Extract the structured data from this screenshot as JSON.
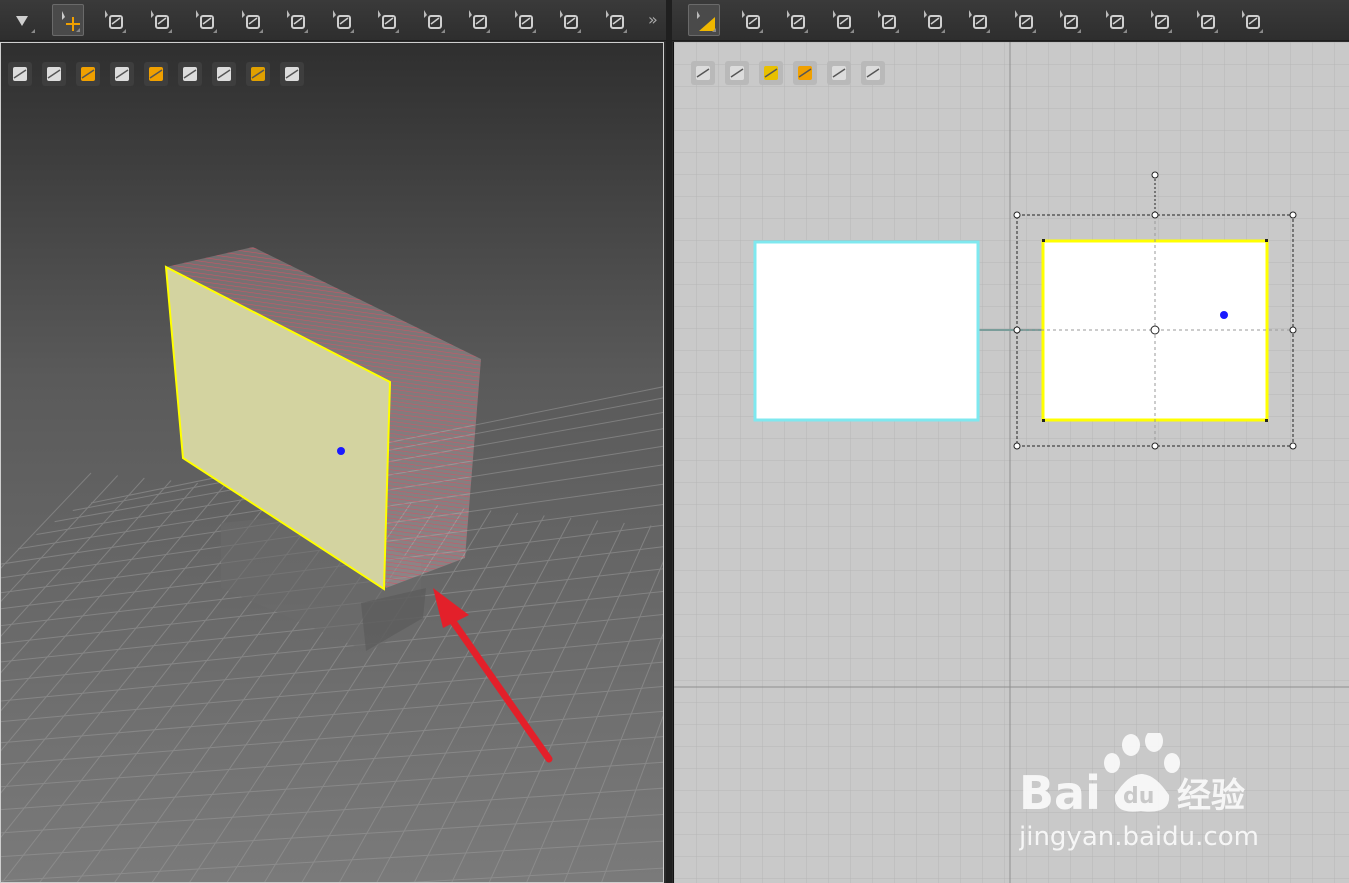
{
  "left_toolbar": {
    "tools": [
      {
        "name": "drop-down-arrow-icon",
        "active": false
      },
      {
        "name": "transform-move-icon",
        "active": true
      },
      {
        "name": "select-mesh-icon",
        "active": false
      },
      {
        "name": "garment-select-icon",
        "active": false
      },
      {
        "name": "pin-tool-icon",
        "active": false
      },
      {
        "name": "fold-arrangement-icon",
        "active": false
      },
      {
        "name": "tack-tool-icon",
        "active": false
      },
      {
        "name": "avatar-arrangement-icon",
        "active": false
      },
      {
        "name": "sewing-tool-icon",
        "active": false
      },
      {
        "name": "grid-mesh-icon",
        "active": false
      },
      {
        "name": "measure-tool-icon",
        "active": false
      },
      {
        "name": "strength-map-icon",
        "active": false
      },
      {
        "name": "button-tool-icon",
        "active": false
      },
      {
        "name": "zipper-tool-icon",
        "active": false
      }
    ],
    "overflow_label": "»"
  },
  "right_toolbar": {
    "tools": [
      {
        "name": "edit-pattern-icon",
        "active": true
      },
      {
        "name": "edit-points-icon",
        "active": false
      },
      {
        "name": "rectangle-tool-icon",
        "active": false
      },
      {
        "name": "polygon-tool-icon",
        "active": false
      },
      {
        "name": "internal-shape-icon",
        "active": false
      },
      {
        "name": "segment-sewing-icon",
        "active": false
      },
      {
        "name": "grid-icon",
        "active": false
      },
      {
        "name": "iron-icon",
        "active": false
      },
      {
        "name": "fold-pattern-icon",
        "active": false
      },
      {
        "name": "free-sewing-icon",
        "active": false
      },
      {
        "name": "pleats-icon",
        "active": false
      },
      {
        "name": "line-tool-icon",
        "active": false
      },
      {
        "name": "t-shirt-icon",
        "active": false
      }
    ]
  },
  "viewport3d_tools": [
    "show-mesh-icon",
    "show-garment-icon",
    "particle-icon",
    "show-avatar-icon",
    "texture-mode-icon",
    "flat-shade-icon",
    "avatar-silhouette-icon",
    "globe-icon",
    "export-icon"
  ],
  "viewport2d_tools": [
    "pen-tool-icon",
    "show-shirt-icon",
    "info-icon",
    "texture-icon",
    "locked-shirt-icon",
    "upload-icon"
  ],
  "colors": {
    "pattern_selected": "#ffff00",
    "pattern_linked": "#7fe8ef",
    "fabric_fill_3d": "#d3d3a0",
    "stitch_red": "#c8263c",
    "arrow_red": "#e3202a",
    "pin_blue": "#1a1aff"
  },
  "watermark": {
    "brand": "Bai",
    "paw_text": "du",
    "cn_text": "经验",
    "url": "jingyan.baidu.com"
  }
}
